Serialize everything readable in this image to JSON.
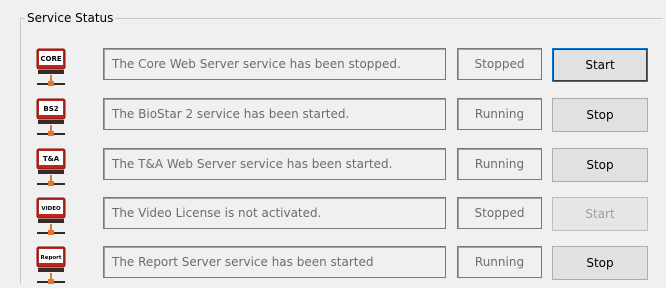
{
  "group": {
    "title": "Service Status"
  },
  "services": [
    {
      "icon_label": "CORE",
      "icon_name": "core-server-icon",
      "message": "The Core Web Server service has been stopped.",
      "status": "Stopped",
      "button": "Start",
      "button_enabled": true,
      "button_focused": true
    },
    {
      "icon_label": "BS2",
      "icon_name": "biostar2-server-icon",
      "message": "The BioStar 2 service has been started.",
      "status": "Running",
      "button": "Stop",
      "button_enabled": true,
      "button_focused": false
    },
    {
      "icon_label": "T&A",
      "icon_name": "ta-server-icon",
      "message": "The T&A Web Server service has been started.",
      "status": "Running",
      "button": "Stop",
      "button_enabled": true,
      "button_focused": false
    },
    {
      "icon_label": "VIDEO",
      "icon_name": "video-server-icon",
      "message": "The Video License is not activated.",
      "status": "Stopped",
      "button": "Start",
      "button_enabled": false,
      "button_focused": false
    },
    {
      "icon_label": "Report",
      "icon_name": "report-server-icon",
      "message": "The Report Server service has been started",
      "status": "Running",
      "button": "Stop",
      "button_enabled": true,
      "button_focused": false
    }
  ],
  "colors": {
    "icon_red": "#c0241c",
    "icon_dark": "#3a2a26",
    "icon_orange": "#e8732a"
  }
}
